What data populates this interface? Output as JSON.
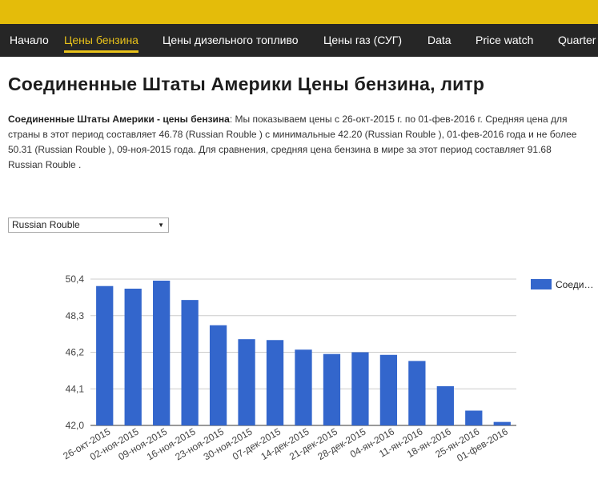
{
  "nav": {
    "items": [
      {
        "label": "Начало",
        "active": false
      },
      {
        "label": "Цены бензина",
        "active": true
      },
      {
        "label": "Цены дизельного топливо",
        "active": false
      },
      {
        "label": "Цены газ (СУГ)",
        "active": false
      },
      {
        "label": "Data",
        "active": false
      },
      {
        "label": "Price watch",
        "active": false
      },
      {
        "label": "Quarter",
        "active": false
      }
    ]
  },
  "page": {
    "title": "Соединенные Штаты Америки Цены бензина, литр",
    "summary_bold": "Соединенные Штаты Америки - цены бензина",
    "summary_text": ": Мы показываем цены с 26-окт-2015 г. по 01-фев-2016 г. Средняя цена для страны в этот период составляет 46.78 (Russian Rouble ) с минимальные 42.20 (Russian Rouble ), 01-фев-2016 года и не более 50.31 (Russian Rouble ), 09-ноя-2015 года. Для сравнения, средняя цена бензина в мире за этот период составляет 91.68 Russian Rouble ."
  },
  "currency_select": {
    "selected": "Russian Rouble"
  },
  "colors": {
    "bar": "#3366cc",
    "brand_yellow": "#e4bc0a",
    "nav_bg": "#262626"
  },
  "chart_data": {
    "type": "bar",
    "categories": [
      "26-окт-2015",
      "02-ноя-2015",
      "09-ноя-2015",
      "16-ноя-2015",
      "23-ноя-2015",
      "30-ноя-2015",
      "07-дек-2015",
      "14-дек-2015",
      "21-дек-2015",
      "28-дек-2015",
      "04-ян-2016",
      "11-ян-2016",
      "18-ян-2016",
      "25-ян-2016",
      "01-фев-2016"
    ],
    "series": [
      {
        "name": "Соеди…",
        "values": [
          50.0,
          49.85,
          50.31,
          49.2,
          47.75,
          46.95,
          46.9,
          46.35,
          46.1,
          46.2,
          46.05,
          45.7,
          44.25,
          42.85,
          42.2
        ]
      }
    ],
    "yticks": [
      "50,4",
      "48,3",
      "46,2",
      "44,1",
      "42,0"
    ],
    "ylim": [
      42.0,
      50.4
    ],
    "grid": true,
    "legend_position": "right"
  }
}
